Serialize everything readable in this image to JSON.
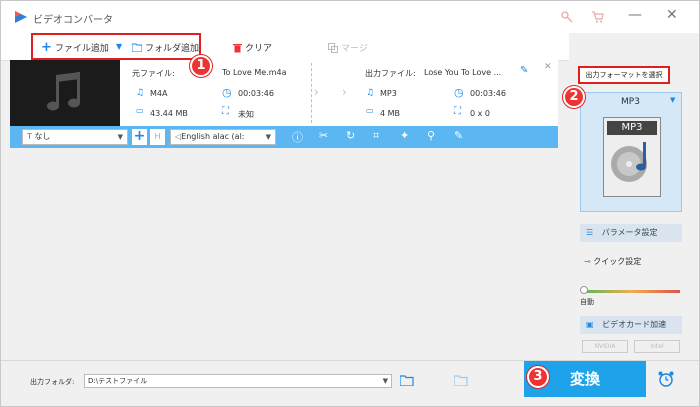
{
  "window": {
    "title": "ビデオコンバータ"
  },
  "toolbar": {
    "add_file": "ファイル追加",
    "add_folder": "フォルダ追加",
    "clear": "クリア",
    "merge": "マージ"
  },
  "file": {
    "source_label": "元ファイル:",
    "source_name": "To Love Me.m4a",
    "source_format": "M4A",
    "source_duration": "00:03:46",
    "source_size": "43.44 MB",
    "source_resolution": "未知",
    "output_label": "出力ファイル:",
    "output_name": "Lose You To Love ...",
    "output_format": "MP3",
    "output_duration": "00:03:46",
    "output_size": "4 MB",
    "output_resolution": "0 x 0"
  },
  "edit_bar": {
    "subtitle": "なし",
    "audio_track": "English alac (al:"
  },
  "right_panel": {
    "select_format": "出力フォーマットを選択",
    "format_name": "MP3",
    "format_icon_text": "MP3",
    "params": "パラメータ設定",
    "quick": "クイック設定",
    "auto": "自動",
    "gpu": "ビデオカード加速",
    "nvidia": "NVIDIA",
    "intel": "Intel"
  },
  "bottom": {
    "output_folder_label": "出力フォルダ:",
    "output_folder_path": "D:\\テストファイル",
    "convert": "変換"
  },
  "badges": [
    "1",
    "2",
    "3"
  ],
  "colors": {
    "accent": "#1ea2ea",
    "edit_bar": "#5bb6f2",
    "highlight": "#e02020"
  }
}
